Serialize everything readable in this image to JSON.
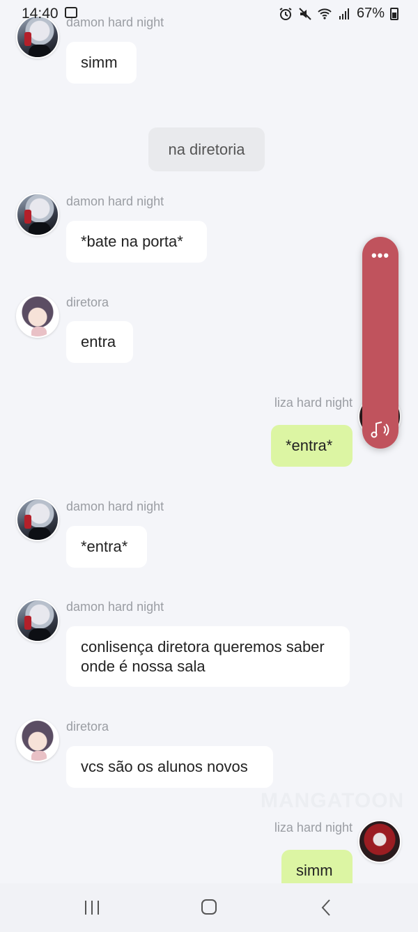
{
  "status": {
    "time": "14:40",
    "battery": "67%"
  },
  "messages": [
    {
      "sender": "damon hard night",
      "text": "simm"
    },
    {
      "narration": "na diretoria"
    },
    {
      "sender": "damon hard night",
      "text": "*bate na porta*"
    },
    {
      "sender": "diretora",
      "text": "entra"
    },
    {
      "sender": "liza hard night",
      "text": "*entra*"
    },
    {
      "sender": "damon hard night",
      "text": "*entra*"
    },
    {
      "sender": "damon hard night",
      "text": "conlisença diretora queremos saber onde é nossa sala"
    },
    {
      "sender": "diretora",
      "text": "vcs são os alunos novos"
    },
    {
      "sender": "liza hard night",
      "text": "simm"
    }
  ],
  "watermark": "MANGATOON",
  "float_panel": {
    "dots": "•••",
    "icon": "music-note-icon"
  },
  "nav": {
    "recent": "recent-apps-icon",
    "home": "home-icon",
    "back": "back-icon"
  },
  "colors": {
    "background": "#f4f5f9",
    "bubble_other": "#ffffff",
    "bubble_me": "#dcf5a3",
    "narration": "#e9eaed",
    "float_panel": "#c0535d"
  }
}
